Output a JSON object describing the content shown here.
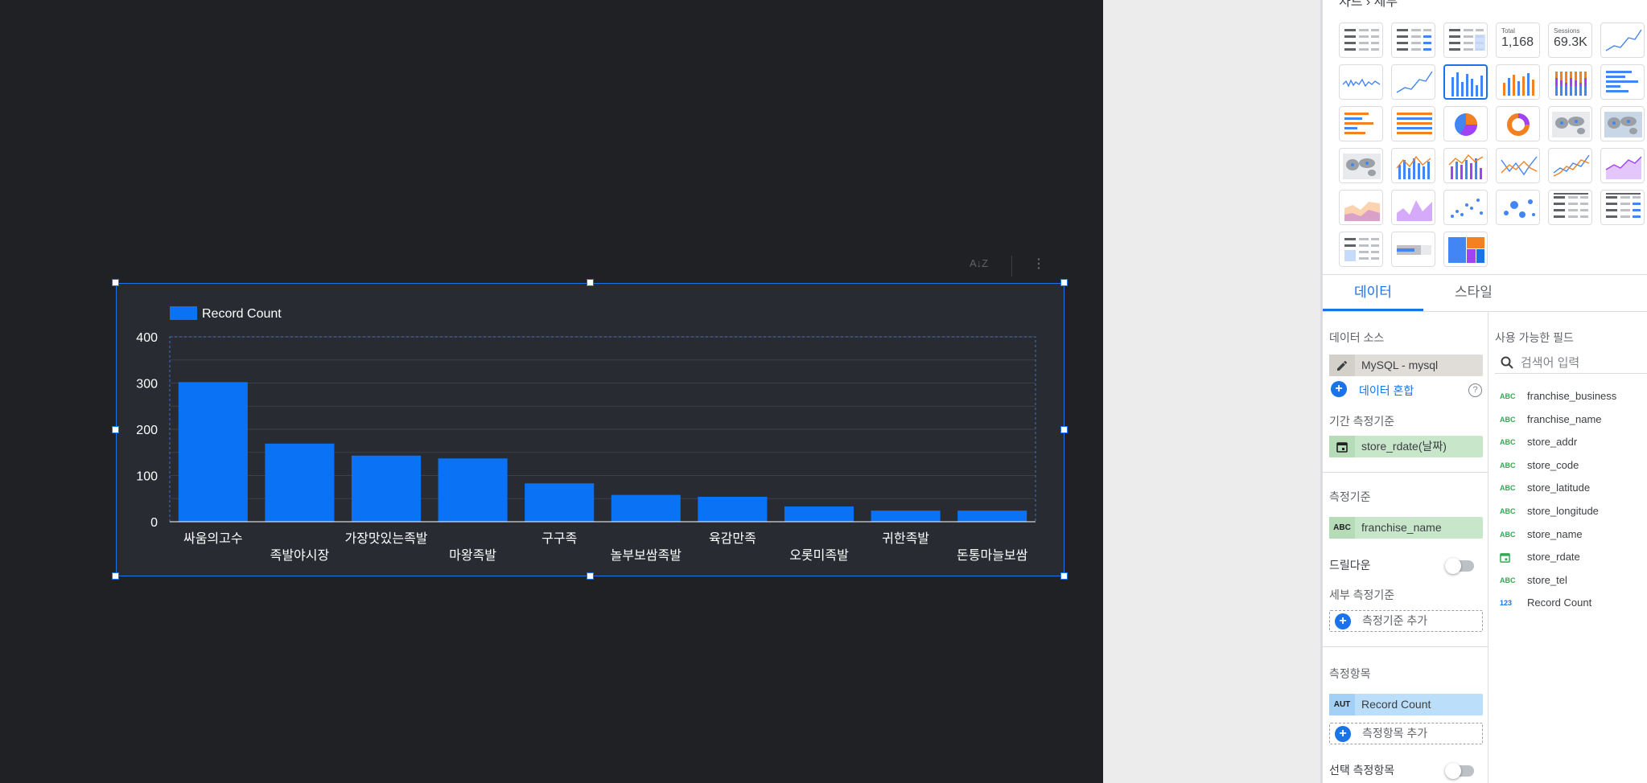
{
  "chart": {
    "legend_label": "Record Count",
    "series_color": "#0a73f5",
    "toolbar": {
      "sort_icon": "A-Z sort",
      "more_icon": "more-vert"
    }
  },
  "chart_data": {
    "type": "bar",
    "title": "",
    "categories": [
      "싸움의고수",
      "족발야시장",
      "가장맛있는족발",
      "마왕족발",
      "구구족",
      "놀부보쌈족발",
      "육감만족",
      "오롯미족발",
      "귀한족발",
      "돈통마늘보쌈"
    ],
    "series": [
      {
        "name": "Record Count",
        "values": [
          302,
          169,
          143,
          137,
          83,
          58,
          54,
          33,
          24,
          24
        ]
      }
    ],
    "yticks": [
      0,
      100,
      200,
      300,
      400
    ],
    "ylim": [
      0,
      400
    ],
    "xlabel": "",
    "ylabel": "",
    "grid": true,
    "legend": "top-left"
  },
  "panel": {
    "title": "차트 › 세부",
    "chart_types": [
      {
        "kind": "table"
      },
      {
        "kind": "table-bars"
      },
      {
        "kind": "table-heatmap"
      },
      {
        "kind": "scorecard",
        "label": "Total",
        "value": "1,168"
      },
      {
        "kind": "scorecard",
        "label": "Sessions",
        "value": "69.3K"
      },
      {
        "kind": "timeseries"
      },
      {
        "kind": "sparkline"
      },
      {
        "kind": "smooth-line"
      },
      {
        "kind": "column",
        "selected": true
      },
      {
        "kind": "stacked-column"
      },
      {
        "kind": "100-stacked-column"
      },
      {
        "kind": "bar"
      },
      {
        "kind": "stacked-bar"
      },
      {
        "kind": "100-stacked-bar"
      },
      {
        "kind": "pie"
      },
      {
        "kind": "donut"
      },
      {
        "kind": "geo-map"
      },
      {
        "kind": "google-map"
      },
      {
        "kind": "geo-map-2"
      },
      {
        "kind": "combo"
      },
      {
        "kind": "stacked-combo"
      },
      {
        "kind": "line"
      },
      {
        "kind": "smoothed-line"
      },
      {
        "kind": "area"
      },
      {
        "kind": "stacked-area"
      },
      {
        "kind": "100-area"
      },
      {
        "kind": "scatter"
      },
      {
        "kind": "bubble"
      },
      {
        "kind": "pivot"
      },
      {
        "kind": "pivot-bars"
      },
      {
        "kind": "pivot-heatmap"
      },
      {
        "kind": "bullet"
      },
      {
        "kind": "treemap"
      }
    ],
    "tabs": [
      "데이터",
      "스타일"
    ],
    "data": {
      "source_label": "데이터 소스",
      "source_value": "MySQL - mysql",
      "blend_link": "데이터 혼합",
      "date_label": "기간 측정기준",
      "date_value": "store_rdate(날짜)",
      "dimension_label": "측정기준",
      "dimension_value": "franchise_name",
      "dimension_type": "ABC",
      "drilldown_label": "드릴다운",
      "breakdown_label": "세부 측정기준",
      "add_dimension": "측정기준 추가",
      "metric_label": "측정항목",
      "metric_type": "AUT",
      "metric_value": "Record Count",
      "add_metric": "측정항목 추가",
      "optional_metric_label": "선택 측정항목"
    },
    "fields": {
      "title": "사용 가능한 필드",
      "search_placeholder": "검색어 입력",
      "items": [
        {
          "type": "ABC",
          "name": "franchise_business"
        },
        {
          "type": "ABC",
          "name": "franchise_name"
        },
        {
          "type": "ABC",
          "name": "store_addr"
        },
        {
          "type": "ABC",
          "name": "store_code"
        },
        {
          "type": "ABC",
          "name": "store_latitude"
        },
        {
          "type": "ABC",
          "name": "store_longitude"
        },
        {
          "type": "ABC",
          "name": "store_name"
        },
        {
          "type": "date",
          "name": "store_rdate"
        },
        {
          "type": "ABC",
          "name": "store_tel"
        },
        {
          "type": "123",
          "name": "Record Count"
        }
      ]
    }
  }
}
